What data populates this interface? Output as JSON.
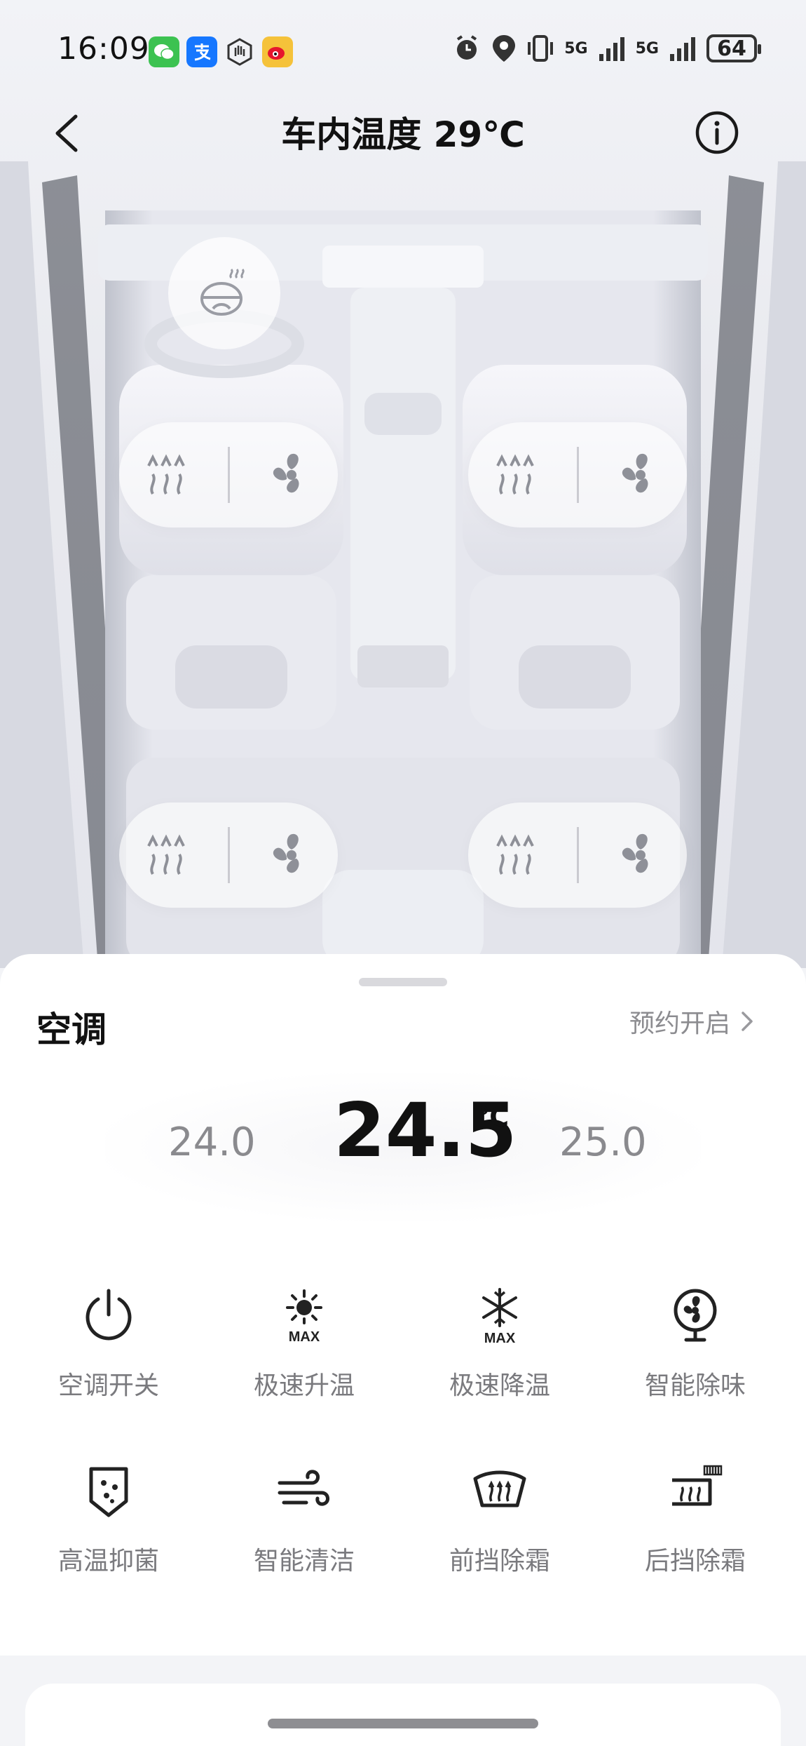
{
  "status_bar": {
    "time": "16:09",
    "apps": [
      "wechat",
      "alipay",
      "hand",
      "weibo"
    ],
    "battery": "64",
    "signal1": "5G",
    "signal2": "5G"
  },
  "header": {
    "title": "车内温度 29℃"
  },
  "seat_controls": [
    {
      "position": "front-left",
      "heat_icon": "heat-waves-icon",
      "fan_icon": "fan-icon"
    },
    {
      "position": "front-right",
      "heat_icon": "heat-waves-icon",
      "fan_icon": "fan-icon"
    },
    {
      "position": "rear-left",
      "heat_icon": "heat-waves-icon",
      "fan_icon": "fan-icon"
    },
    {
      "position": "rear-right",
      "heat_icon": "heat-waves-icon",
      "fan_icon": "fan-icon"
    }
  ],
  "steering_wheel": {
    "icon": "steering-wheel-heat-icon"
  },
  "ac": {
    "title": "空调",
    "schedule_label": "预约开启",
    "temp_prev": "24.0",
    "temp_current": "24.5",
    "temp_unit": "℃",
    "temp_next": "25.0"
  },
  "functions": [
    {
      "label": "空调开关",
      "icon": "power-icon"
    },
    {
      "label": "极速升温",
      "icon": "sun-max-icon"
    },
    {
      "label": "极速降温",
      "icon": "snowflake-max-icon"
    },
    {
      "label": "智能除味",
      "icon": "fan-purify-icon"
    },
    {
      "label": "高温抑菌",
      "icon": "shield-dots-icon"
    },
    {
      "label": "智能清洁",
      "icon": "wind-icon"
    },
    {
      "label": "前挡除霜",
      "icon": "front-defrost-icon"
    },
    {
      "label": "后挡除霜",
      "icon": "rear-defrost-icon"
    }
  ],
  "colors": {
    "accent_text": "#111111",
    "muted_text": "#7a7a7e",
    "weibo": "#f5c23a",
    "wechat": "#3cc251",
    "alipay": "#1677ff"
  }
}
